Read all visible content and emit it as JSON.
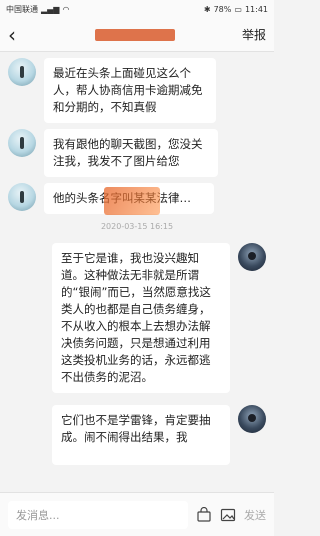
{
  "status": {
    "carrier": "中国联通",
    "battery": "78%",
    "time": "11:41"
  },
  "nav": {
    "back_symbol": "‹",
    "report_label": "举报"
  },
  "messages": [
    {
      "side": "left",
      "text": "最近在头条上面碰见这么个人，帮人协商信用卡逾期减免和分期的，不知真假"
    },
    {
      "side": "left",
      "text": "我有跟他的聊天截图，您没关注我，我发不了图片给您"
    },
    {
      "side": "left",
      "text": "他的头条名字叫某某法律…"
    },
    {
      "timestamp": "2020-03-15 16:15"
    },
    {
      "side": "right",
      "text": "至于它是谁，我也没兴趣知道。这种做法无非就是所谓的“银闹”而已，当然愿意找这类人的也都是自己债务缠身，不从收入的根本上去想办法解决债务问题，只是想通过利用这类投机业务的话，永远都逃不出债务的泥沼。"
    },
    {
      "side": "right",
      "text": "它们也不是学雷锋，肯定要抽成。闹不闹得出结果，我"
    }
  ],
  "composer": {
    "placeholder": "发消息...",
    "send_label": "发送"
  }
}
